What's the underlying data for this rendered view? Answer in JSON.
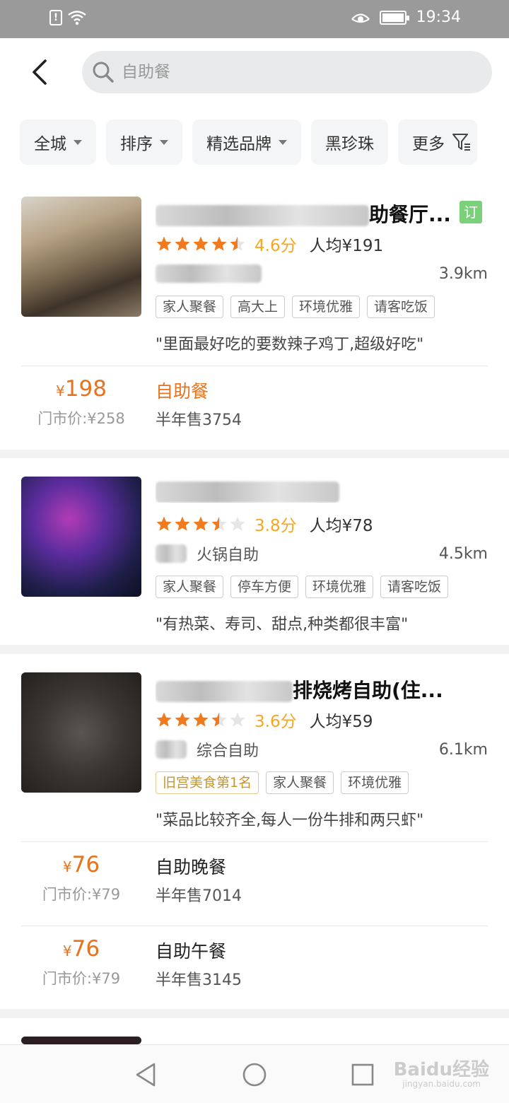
{
  "status_bar": {
    "time": "19:34",
    "icons": [
      "alert-icon",
      "wifi-icon",
      "eye-icon",
      "battery-icon"
    ]
  },
  "search": {
    "placeholder": "自助餐"
  },
  "filters": [
    {
      "label": "全城",
      "has_caret": true
    },
    {
      "label": "排序",
      "has_caret": true
    },
    {
      "label": "精选品牌",
      "has_caret": true
    },
    {
      "label": "黑珍珠",
      "has_caret": false
    },
    {
      "label": "更多",
      "icon": "funnel-icon"
    }
  ],
  "colors": {
    "accent_orange": "#e8731e",
    "star_orange": "#f5a623",
    "order_green": "#7bd17b"
  },
  "listings": [
    {
      "name_visible": "助餐厅...",
      "badge": "订",
      "stars": 4.5,
      "score": "4.6分",
      "avg": "人均¥191",
      "category": "",
      "distance": "3.9km",
      "tags": [
        "家人聚餐",
        "高大上",
        "环境优雅",
        "请客吃饭"
      ],
      "quote": "\"里面最好吃的要数辣子鸡丁,超级好吃\"",
      "deals": [
        {
          "price": "198",
          "currency": "¥",
          "orig": "门市价:¥258",
          "name": "自助餐",
          "sold": "半年售3754"
        }
      ]
    },
    {
      "name_visible": "",
      "stars": 3.5,
      "score": "3.8分",
      "avg": "人均¥78",
      "category": "火锅自助",
      "distance": "4.5km",
      "tags": [
        "家人聚餐",
        "停车方便",
        "环境优雅",
        "请客吃饭"
      ],
      "quote": "\"有热菜、寿司、甜点,种类都很丰富\"",
      "deals": []
    },
    {
      "name_visible": "排烧烤自助(住...",
      "stars": 3.5,
      "score": "3.6分",
      "avg": "人均¥59",
      "category": "综合自助",
      "distance": "6.1km",
      "rank_tag": "旧宫美食第1名",
      "tags": [
        "家人聚餐",
        "环境优雅"
      ],
      "quote": "\"菜品比较齐全,每人一份牛排和两只虾\"",
      "deals": [
        {
          "price": "76",
          "currency": "¥",
          "orig": "门市价:¥79",
          "name": "自助晚餐",
          "sold": "半年售7014"
        },
        {
          "price": "76",
          "currency": "¥",
          "orig": "门市价:¥79",
          "name": "自助午餐",
          "sold": "半年售3145"
        }
      ]
    }
  ],
  "watermark": {
    "brand": "Baidu经验",
    "url": "jingyan.baidu.com"
  }
}
